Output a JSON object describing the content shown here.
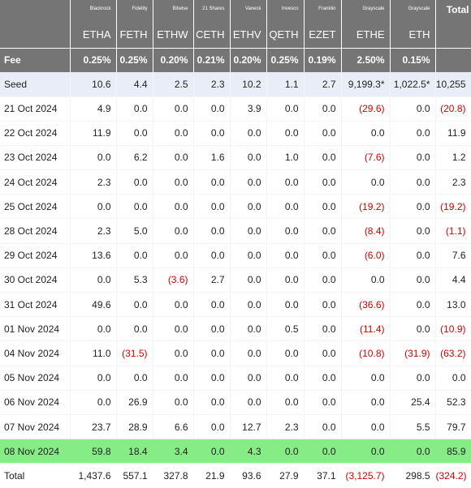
{
  "issuers": [
    "Blackrock",
    "Fidelity",
    "Bitwise",
    "21 Shares",
    "Vaneck",
    "Invesco",
    "Franklin",
    "Grayscale",
    "Grayscale"
  ],
  "total_label": "Total",
  "tickers": [
    "ETHA",
    "FETH",
    "ETHW",
    "CETH",
    "ETHV",
    "QETH",
    "EZET",
    "ETHE",
    "ETH"
  ],
  "fee_label": "Fee",
  "fees": [
    "0.25%",
    "0.25%",
    "0.20%",
    "0.21%",
    "0.20%",
    "0.25%",
    "0.19%",
    "2.50%",
    "0.15%"
  ],
  "seed": {
    "label": "Seed",
    "values": [
      "10.6",
      "4.4",
      "2.5",
      "2.3",
      "10.2",
      "1.1",
      "2.7",
      "9,199.3*",
      "1,022.5*"
    ],
    "total": "10,255"
  },
  "rows": [
    {
      "date": "21 Oct 2024",
      "values": [
        "4.9",
        "0.0",
        "0.0",
        "0.0",
        "3.9",
        "0.0",
        "0.0",
        "(29.6)",
        "0.0"
      ],
      "total": "(20.8)"
    },
    {
      "date": "22 Oct 2024",
      "values": [
        "11.9",
        "0.0",
        "0.0",
        "0.0",
        "0.0",
        "0.0",
        "0.0",
        "0.0",
        "0.0"
      ],
      "total": "11.9"
    },
    {
      "date": "23 Oct 2024",
      "values": [
        "0.0",
        "6.2",
        "0.0",
        "1.6",
        "0.0",
        "1.0",
        "0.0",
        "(7.6)",
        "0.0"
      ],
      "total": "1.2"
    },
    {
      "date": "24 Oct 2024",
      "values": [
        "2.3",
        "0.0",
        "0.0",
        "0.0",
        "0.0",
        "0.0",
        "0.0",
        "0.0",
        "0.0"
      ],
      "total": "2.3"
    },
    {
      "date": "25 Oct 2024",
      "values": [
        "0.0",
        "0.0",
        "0.0",
        "0.0",
        "0.0",
        "0.0",
        "0.0",
        "(19.2)",
        "0.0"
      ],
      "total": "(19.2)"
    },
    {
      "date": "28 Oct 2024",
      "values": [
        "2.3",
        "5.0",
        "0.0",
        "0.0",
        "0.0",
        "0.0",
        "0.0",
        "(8.4)",
        "0.0"
      ],
      "total": "(1.1)"
    },
    {
      "date": "29 Oct 2024",
      "values": [
        "13.6",
        "0.0",
        "0.0",
        "0.0",
        "0.0",
        "0.0",
        "0.0",
        "(6.0)",
        "0.0"
      ],
      "total": "7.6"
    },
    {
      "date": "30 Oct 2024",
      "values": [
        "0.0",
        "5.3",
        "(3.6)",
        "2.7",
        "0.0",
        "0.0",
        "0.0",
        "0.0",
        "0.0"
      ],
      "total": "4.4"
    },
    {
      "date": "31 Oct 2024",
      "values": [
        "49.6",
        "0.0",
        "0.0",
        "0.0",
        "0.0",
        "0.0",
        "0.0",
        "(36.6)",
        "0.0"
      ],
      "total": "13.0"
    },
    {
      "date": "01 Nov 2024",
      "values": [
        "0.0",
        "0.0",
        "0.0",
        "0.0",
        "0.0",
        "0.5",
        "0.0",
        "(11.4)",
        "0.0"
      ],
      "total": "(10.9)"
    },
    {
      "date": "04 Nov 2024",
      "values": [
        "11.0",
        "(31.5)",
        "0.0",
        "0.0",
        "0.0",
        "0.0",
        "0.0",
        "(10.8)",
        "(31.9)"
      ],
      "total": "(63.2)"
    },
    {
      "date": "05 Nov 2024",
      "values": [
        "0.0",
        "0.0",
        "0.0",
        "0.0",
        "0.0",
        "0.0",
        "0.0",
        "0.0",
        "0.0"
      ],
      "total": "0.0"
    },
    {
      "date": "06 Nov 2024",
      "values": [
        "0.0",
        "26.9",
        "0.0",
        "0.0",
        "0.0",
        "0.0",
        "0.0",
        "0.0",
        "25.4"
      ],
      "total": "52.3"
    },
    {
      "date": "07 Nov 2024",
      "values": [
        "23.7",
        "28.9",
        "6.6",
        "0.0",
        "12.7",
        "2.3",
        "0.0",
        "0.0",
        "5.5"
      ],
      "total": "79.7"
    },
    {
      "date": "08 Nov 2024",
      "values": [
        "59.8",
        "18.4",
        "3.4",
        "0.0",
        "4.3",
        "0.0",
        "0.0",
        "0.0",
        "0.0"
      ],
      "total": "85.9",
      "highlight": true
    }
  ],
  "totals": {
    "label": "Total",
    "values": [
      "1,437.6",
      "557.1",
      "327.8",
      "21.9",
      "93.6",
      "27.9",
      "37.1",
      "(3,125.7)",
      "298.5"
    ],
    "total": "(324.2)"
  },
  "colors": {
    "header_bg": "#757575",
    "seed_bg": "#e8edf7",
    "highlight_bg": "#86ec86",
    "negative": "#d00000"
  }
}
